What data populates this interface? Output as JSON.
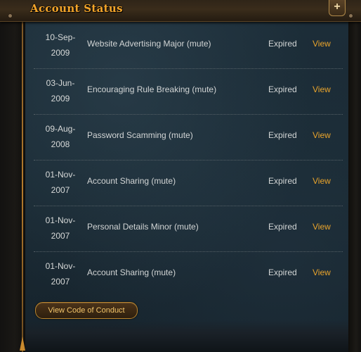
{
  "header": {
    "title": "Account Status",
    "expand_label": "+"
  },
  "records": [
    {
      "date": "10-Sep-\n2009",
      "offence": "Website Advertising Major (mute)",
      "status": "Expired",
      "action": "View"
    },
    {
      "date": "03-Jun-\n2009",
      "offence": "Encouraging Rule Breaking (mute)",
      "status": "Expired",
      "action": "View"
    },
    {
      "date": "09-Aug-\n2008",
      "offence": "Password Scamming (mute)",
      "status": "Expired",
      "action": "View"
    },
    {
      "date": "01-Nov-\n2007",
      "offence": "Account Sharing (mute)",
      "status": "Expired",
      "action": "View"
    },
    {
      "date": "01-Nov-\n2007",
      "offence": "Personal Details Minor (mute)",
      "status": "Expired",
      "action": "View"
    },
    {
      "date": "01-Nov-\n2007",
      "offence": "Account Sharing (mute)",
      "status": "Expired",
      "action": "View"
    }
  ],
  "footer": {
    "conduct_button": "View Code of Conduct"
  },
  "colors": {
    "accent": "#e9a42c",
    "title": "#f4a52a",
    "panel": "#1c2d38",
    "text": "#d2d5d5"
  }
}
